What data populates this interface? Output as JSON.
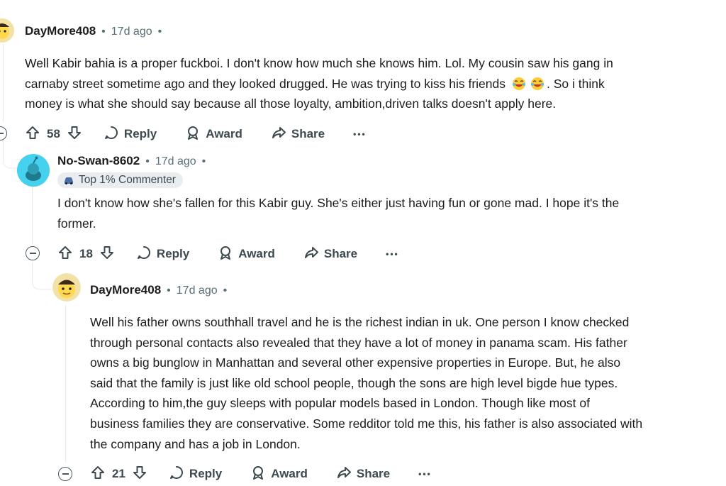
{
  "comments": [
    {
      "username": "DayMore408",
      "age": "17d ago",
      "body_lines": [
        "Well Kabir bahia is a proper fuckboi. I don't know how much she knows him. Lol. My cousin saw his gang in",
        "carnaby street sometime ago and they looked drugged. He was trying to kiss his friends",
        "money is what she should say because all those loyalty, ambition,driven talks doesn't apply here."
      ],
      "body_line2_tail": ". So i think",
      "votes": "58",
      "reply_label": "Reply",
      "award_label": "Award",
      "share_label": "Share"
    },
    {
      "username": "No-Swan-8602",
      "age": "17d ago",
      "badge": "Top 1% Commenter",
      "body_lines": [
        "I don't know how she's fallen for this Kabir guy. She's either just having fun or gone mad. I hope it's the",
        "former."
      ],
      "votes": "18",
      "reply_label": "Reply",
      "award_label": "Award",
      "share_label": "Share"
    },
    {
      "username": "DayMore408",
      "age": "17d ago",
      "body_lines": [
        "Well his father owns southhall travel and he is the richest indian in uk. One person I know checked",
        "through personal contacts also revealed that they have a lot of money in panama scam. His father",
        "owns a big bunglow in Manhattan and several other expensive properties in Europe. But, he also",
        "said that the family is just like old school people, though the sons are high level bigde hue types.",
        "According to him,the guy sleeps with popular models based in London. Though like most of",
        "business families they are conservative. Some redditor told me this, his father is also associated with",
        "the company and has a job in London."
      ],
      "votes": "21",
      "reply_label": "Reply",
      "award_label": "Award",
      "share_label": "Share"
    }
  ],
  "more_label": "•••",
  "separator": "•",
  "colors": {
    "text": "#1c1c1c",
    "meta": "#576f76",
    "action": "#3c4a4f",
    "avatar_blue": "#46d1ee",
    "thread": "#e5ebee"
  }
}
